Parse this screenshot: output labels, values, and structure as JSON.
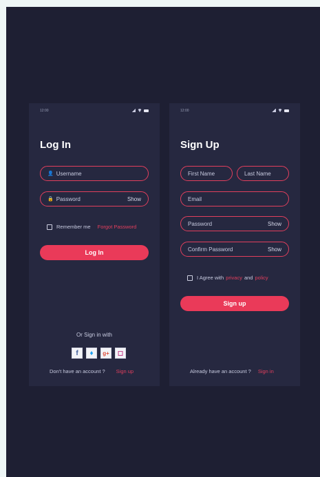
{
  "login": {
    "status_time": "12:00",
    "title": "Log In",
    "username_placeholder": "Username",
    "password_placeholder": "Password",
    "show_label": "Show",
    "remember_label": "Remember me",
    "forgot_label": "Forgot Password",
    "login_button": "Log In",
    "or_sign_in": "Or Sign in with",
    "no_account": "Don't have an account ?",
    "signup_link": "Sign up"
  },
  "signup": {
    "status_time": "12:00",
    "title": "Sign Up",
    "first_name": "First Name",
    "last_name": "Last Name",
    "email": "Email",
    "password": "Password",
    "confirm_password": "Confirm Password",
    "show_label": "Show",
    "agree_prefix": "I Agree with",
    "privacy": "privacy",
    "and": "and",
    "policy": "policy",
    "signup_button": "Sign up",
    "have_account": "Already have an account ?",
    "signin_link": "Sign in"
  },
  "icons": [
    "user-icon",
    "lock-icon",
    "facebook-icon",
    "twitter-icon",
    "google-plus-icon",
    "instagram-icon"
  ],
  "colors": {
    "accent": "#ea3a59",
    "background": "#1e1f33",
    "card": "#262840"
  }
}
